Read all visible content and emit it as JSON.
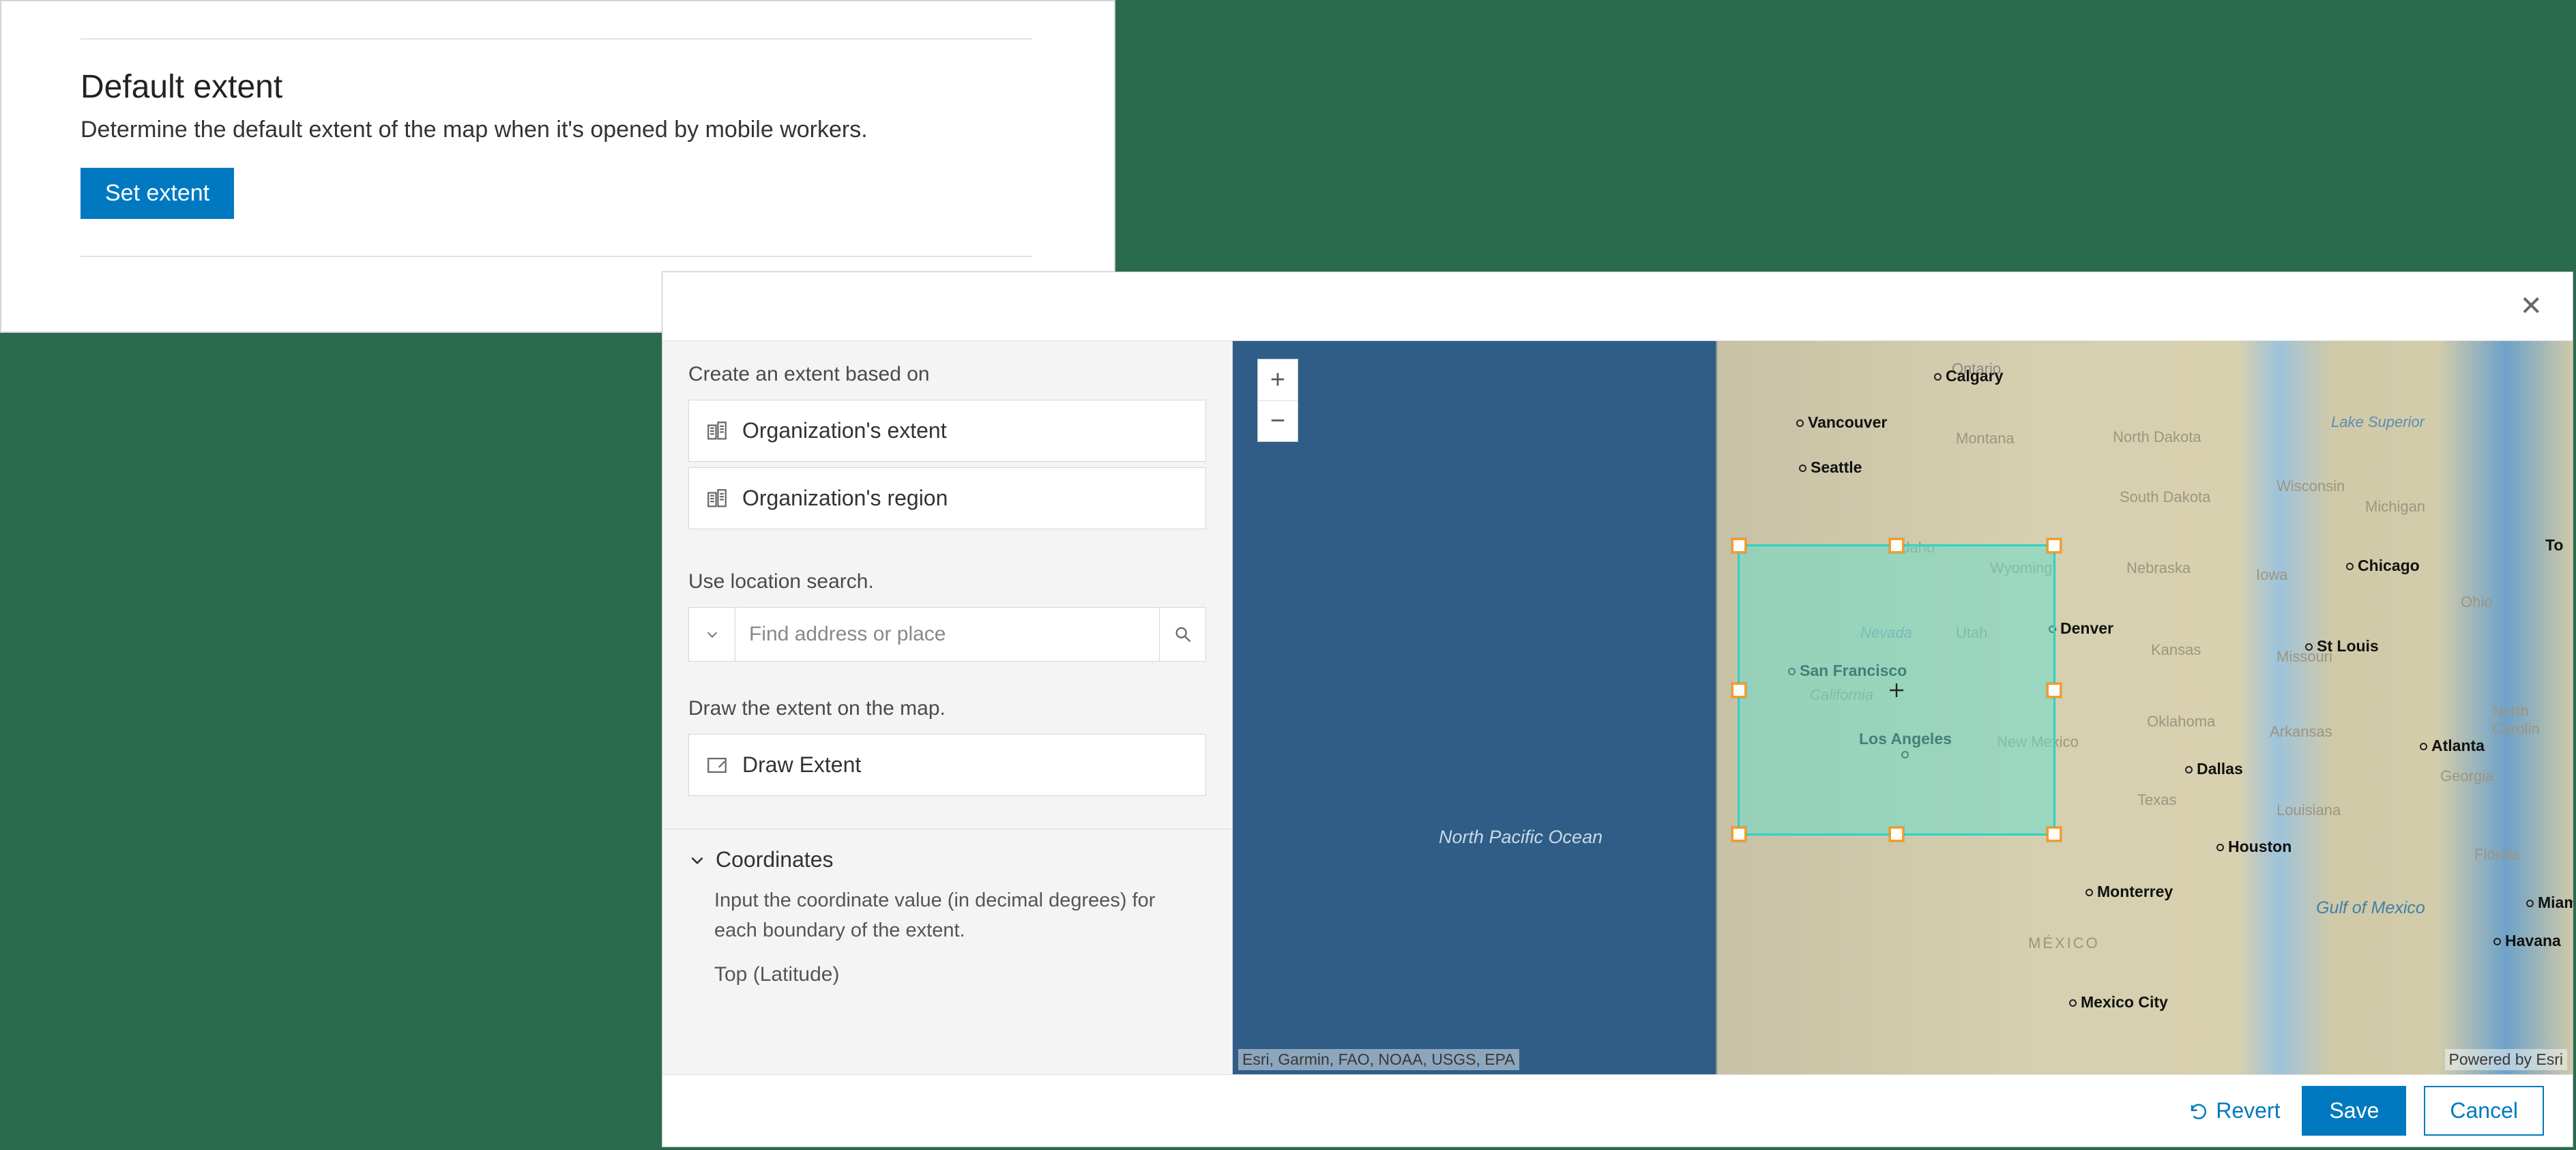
{
  "card": {
    "title": "Default extent",
    "description": "Determine the default extent of the map when it's opened by mobile workers.",
    "button": "Set extent"
  },
  "dialog": {
    "panel": {
      "create_label": "Create an extent based on",
      "option_org_extent": "Organization's extent",
      "option_org_region": "Organization's region",
      "search_label": "Use location search.",
      "search_placeholder": "Find address or place",
      "draw_label": "Draw the extent on the map.",
      "draw_button": "Draw Extent",
      "coords_header": "Coordinates",
      "coords_desc": "Input the coordinate value (in decimal degrees) for each boundary of the extent.",
      "coords_top": "Top (Latitude)"
    },
    "footer": {
      "revert": "Revert",
      "save": "Save",
      "cancel": "Cancel"
    },
    "map": {
      "attribution": "Esri, Garmin, FAO, NOAA, USGS, EPA",
      "powered": "Powered by Esri",
      "ocean_label": "North Pacific\nOcean",
      "gulf_label": "Gulf of\nMexico",
      "states": {
        "montana": "Montana",
        "north_dakota": "North Dakota",
        "wisconsin": "Wisconsin",
        "michigan": "Michigan",
        "idaho": "Idaho",
        "wyoming": "Wyoming",
        "nebraska": "Nebraska",
        "iowa": "Iowa",
        "ohio": "Ohio",
        "nevada": "Nevada",
        "utah": "Utah",
        "kansas": "Kansas",
        "missouri": "Missouri",
        "california": "California",
        "oklahoma": "Oklahoma",
        "arkansas": "Arkansas",
        "new_mexico": "New Mexico",
        "texas": "Texas",
        "louisiana": "Louisiana",
        "georgia": "Georgia",
        "florida": "Florida",
        "north_carolin": "North Carolin",
        "south_dakota": "South Dakota",
        "lake_superior": "Lake\nSuperior",
        "mexico": "MÉXICO",
        "ontario": "Ontario"
      },
      "cities": {
        "calgary": "Calgary",
        "vancouver": "Vancouver",
        "seattle": "Seattle",
        "san_francisco": "San Francisco",
        "los_angeles": "Los Angeles",
        "denver": "Denver",
        "chicago": "Chicago",
        "st_louis": "St Louis",
        "dallas": "Dallas",
        "houston": "Houston",
        "atlanta": "Atlanta",
        "miami": "Miami",
        "to": "To",
        "monterrey": "Monterrey",
        "mexico_city": "Mexico City",
        "havana": "Havana"
      }
    }
  }
}
